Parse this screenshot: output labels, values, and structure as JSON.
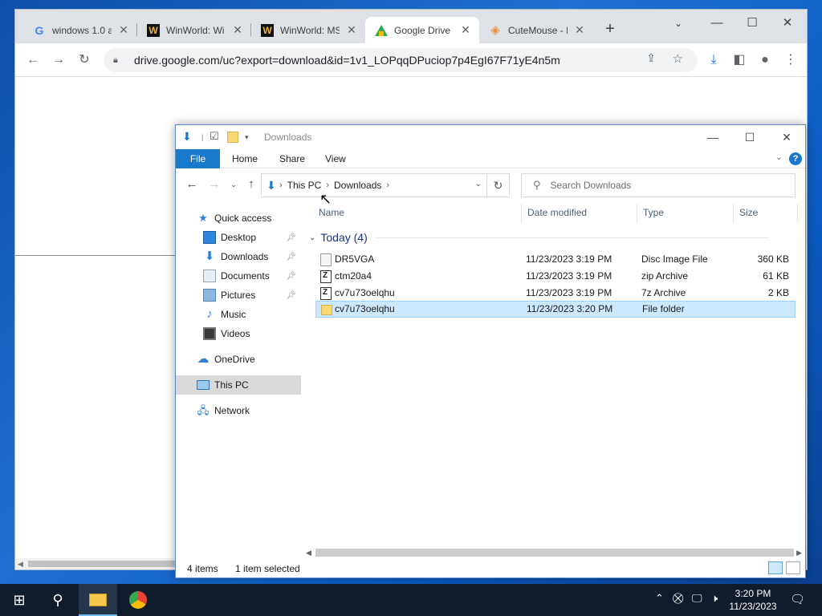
{
  "chrome": {
    "tabs": [
      {
        "title": "windows 1.0 a",
        "favicon": "google-g-icon"
      },
      {
        "title": "WinWorld: Wi",
        "favicon": "winworld-icon"
      },
      {
        "title": "WinWorld: MS",
        "favicon": "winworld-icon"
      },
      {
        "title": "Google Drive",
        "favicon": "google-drive-icon",
        "active": true
      },
      {
        "title": "CuteMouse - I",
        "favicon": "cutemouse-icon"
      }
    ],
    "url": "drive.google.com/uc?export=download&id=1v1_LOPqqDPuciop7p4EgI67F71yE4n5m",
    "colors": {
      "tabstrip": "#dee1e6",
      "download_icon": "#1a73e8"
    }
  },
  "explorer": {
    "title": "Downloads",
    "ribbon": {
      "file": "File",
      "home": "Home",
      "share": "Share",
      "view": "View",
      "help": "?"
    },
    "address": {
      "crumbs": [
        "This PC",
        "Downloads"
      ]
    },
    "search_placeholder": "Search Downloads",
    "nav": {
      "quick_access": "Quick access",
      "desktop": "Desktop",
      "downloads": "Downloads",
      "documents": "Documents",
      "pictures": "Pictures",
      "music": "Music",
      "videos": "Videos",
      "onedrive": "OneDrive",
      "this_pc": "This PC",
      "network": "Network"
    },
    "columns": {
      "name": "Name",
      "date": "Date modified",
      "type": "Type",
      "size": "Size"
    },
    "group": "Today (4)",
    "files": [
      {
        "name": "DR5VGA",
        "date": "11/23/2023 3:19 PM",
        "type": "Disc Image File",
        "size": "360 KB",
        "icon": "disc-image-icon"
      },
      {
        "name": "ctm20a4",
        "date": "11/23/2023 3:19 PM",
        "type": "zip Archive",
        "size": "61 KB",
        "icon": "zip-archive-icon"
      },
      {
        "name": "cv7u73oelqhu",
        "date": "11/23/2023 3:19 PM",
        "type": "7z Archive",
        "size": "2 KB",
        "icon": "7z-archive-icon"
      },
      {
        "name": "cv7u73oelqhu",
        "date": "11/23/2023 3:20 PM",
        "type": "File folder",
        "size": "",
        "icon": "folder-icon",
        "selected": true
      }
    ],
    "status": {
      "items": "4 items",
      "selected": "1 item selected"
    },
    "colors": {
      "file_tab": "#1979ca",
      "selection": "#cce8ff",
      "group_header": "#1e3287"
    }
  },
  "taskbar": {
    "time": "3:20 PM",
    "date": "11/23/2023",
    "colors": {
      "background": "#101b2b"
    }
  }
}
